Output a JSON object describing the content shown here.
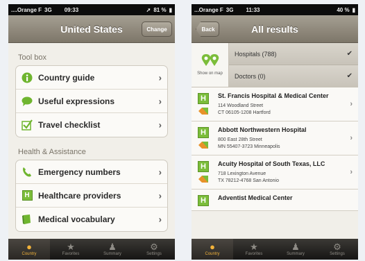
{
  "left": {
    "status": {
      "carrier": "....Orange F",
      "network": "3G",
      "time": "09:33",
      "battery": "81 %"
    },
    "title": "United States",
    "change_label": "Change",
    "sections": [
      {
        "title": "Tool box",
        "items": [
          "Country guide",
          "Useful expressions",
          "Travel checklist"
        ]
      },
      {
        "title": "Health & Assistance",
        "items": [
          "Emergency numbers",
          "Healthcare providers",
          "Medical vocabulary"
        ]
      }
    ],
    "tabs": [
      "Country",
      "Favorites",
      "Summary",
      "Settings"
    ]
  },
  "right": {
    "status": {
      "carrier": "...Orange F",
      "network": "3G",
      "time": "11:33",
      "battery": "40 %"
    },
    "title": "All results",
    "back_label": "Back",
    "map_label": "Show on map",
    "filters": [
      "Hospitals (788)",
      "Doctors (0)"
    ],
    "results": [
      {
        "name": "St. Francis Hospital & Medical Center",
        "address1": "114 Woodland Street",
        "address2": "CT 06105-1208  Hartford"
      },
      {
        "name": "Abbott Northwestern Hospital",
        "address1": "800 East 28th Street",
        "address2": "MN 55407-3723 Minneapolis"
      },
      {
        "name": "Acuity Hospital of South Texas, LLC",
        "address1": "718 Lexington Avenue",
        "address2": "TX 78212-4768  San Antonio"
      },
      {
        "name": "Adventist Medical Center",
        "address1": "",
        "address2": ""
      }
    ],
    "tabs": [
      "Country",
      "Favorites",
      "Summary",
      "Settings"
    ]
  },
  "colors": {
    "accent_tab": "#f2b23a",
    "nav": "#8e877a",
    "healthcare_green": "#7bbd3a"
  }
}
